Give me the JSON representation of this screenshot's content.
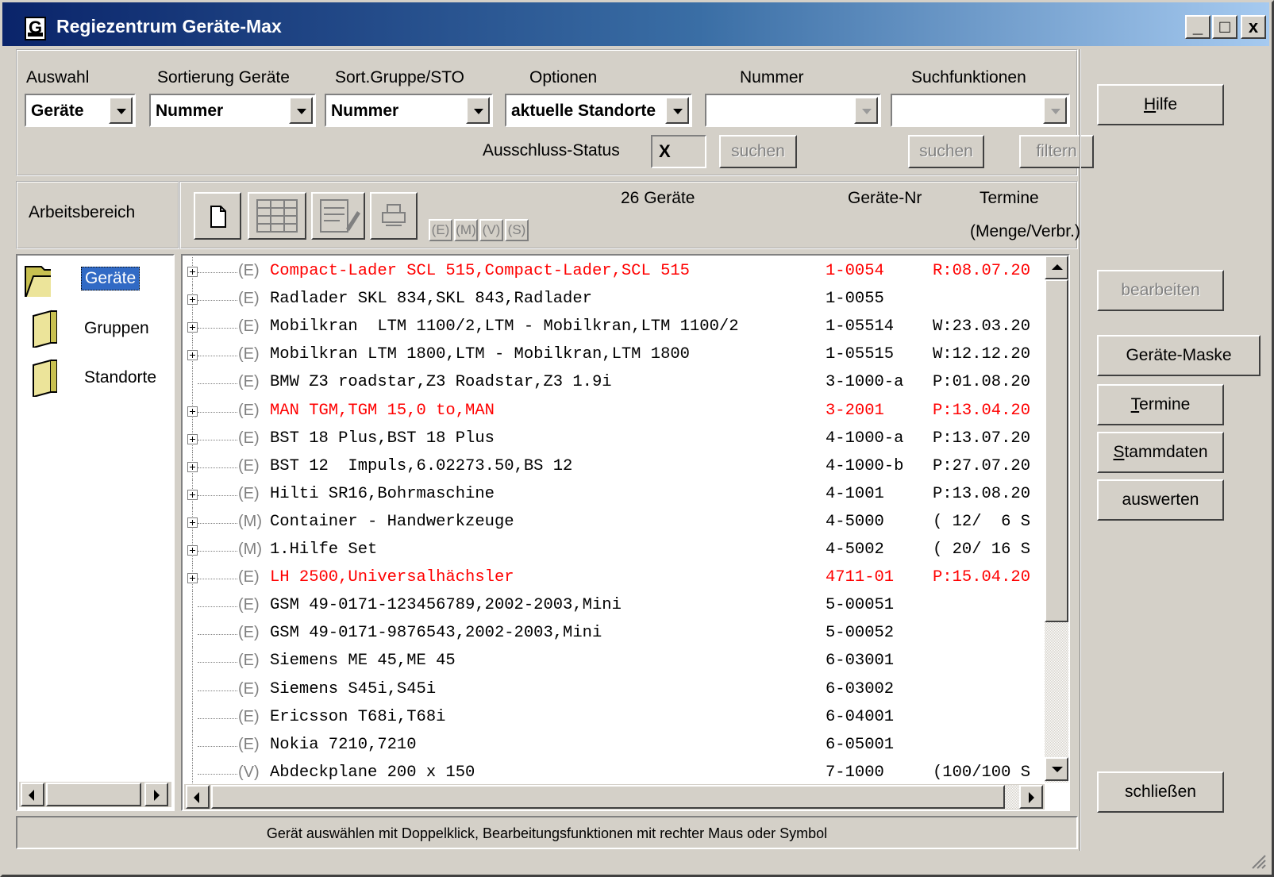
{
  "window": {
    "title": "Regiezentrum Geräte-Max",
    "app_icon_letter": "G",
    "minimize": "_",
    "maximize": "□",
    "close": "x"
  },
  "filters": {
    "auswahl": {
      "label": "Auswahl",
      "value": "Geräte"
    },
    "sortierung_geraete": {
      "label": "Sortierung Geräte",
      "value": "Nummer"
    },
    "sort_gruppe": {
      "label": "Sort.Gruppe/STO",
      "value": "Nummer"
    },
    "optionen": {
      "label": "Optionen",
      "value": "aktuelle Standorte"
    },
    "nummer": {
      "label": "Nummer",
      "value": ""
    },
    "suchfunktionen": {
      "label": "Suchfunktionen",
      "value": ""
    },
    "ausschluss_status": {
      "label": "Ausschluss-Status",
      "value": "X"
    },
    "suchen_nummer": "suchen",
    "suchen_funktion": "suchen",
    "filtern": "filtern"
  },
  "workspace": {
    "label": "Arbeitsbereich",
    "count_label": "26 Geräte",
    "col_nr": "Geräte-Nr",
    "col_termine": "Termine",
    "col_termine_sub": "(Menge/Verbr.)",
    "type_buttons": [
      "(E)",
      "(M)",
      "(V)",
      "(S)"
    ]
  },
  "nav": {
    "items": [
      {
        "label": "Geräte",
        "selected": true
      },
      {
        "label": "Gruppen",
        "selected": false
      },
      {
        "label": "Standorte",
        "selected": false
      }
    ]
  },
  "rows": [
    {
      "kind": "(E)",
      "name": "Compact-Lader SCL 515,Compact-Lader,SCL 515",
      "nr": "1-0054",
      "term": "R:08.07.20",
      "red": true,
      "exp": true
    },
    {
      "kind": "(E)",
      "name": "Radlader SKL 834,SKL 843,Radlader",
      "nr": "1-0055",
      "term": "",
      "red": false,
      "exp": true
    },
    {
      "kind": "(E)",
      "name": "Mobilkran  LTM 1100/2,LTM - Mobilkran,LTM 1100/2",
      "nr": "1-05514",
      "term": "W:23.03.20",
      "red": false,
      "exp": true
    },
    {
      "kind": "(E)",
      "name": "Mobilkran LTM 1800,LTM - Mobilkran,LTM 1800",
      "nr": "1-05515",
      "term": "W:12.12.20",
      "red": false,
      "exp": true
    },
    {
      "kind": "(E)",
      "name": "BMW Z3 roadstar,Z3 Roadstar,Z3 1.9i",
      "nr": "3-1000-a",
      "term": "P:01.08.20",
      "red": false,
      "exp": false
    },
    {
      "kind": "(E)",
      "name": "MAN TGM,TGM 15,0 to,MAN",
      "nr": "3-2001",
      "term": "P:13.04.20",
      "red": true,
      "exp": true
    },
    {
      "kind": "(E)",
      "name": "BST 18 Plus,BST 18 Plus",
      "nr": "4-1000-a",
      "term": "P:13.07.20",
      "red": false,
      "exp": true
    },
    {
      "kind": "(E)",
      "name": "BST 12  Impuls,6.02273.50,BS 12",
      "nr": "4-1000-b",
      "term": "P:27.07.20",
      "red": false,
      "exp": true
    },
    {
      "kind": "(E)",
      "name": "Hilti SR16,Bohrmaschine",
      "nr": "4-1001",
      "term": "P:13.08.20",
      "red": false,
      "exp": true
    },
    {
      "kind": "(M)",
      "name": "Container - Handwerkzeuge",
      "nr": "4-5000",
      "term": "( 12/  6 S",
      "red": false,
      "exp": true
    },
    {
      "kind": "(M)",
      "name": "1.Hilfe Set",
      "nr": "4-5002",
      "term": "( 20/ 16 S",
      "red": false,
      "exp": true
    },
    {
      "kind": "(E)",
      "name": "LH 2500,Universalhächsler",
      "nr": "4711-01",
      "term": "P:15.04.20",
      "red": true,
      "exp": true
    },
    {
      "kind": "(E)",
      "name": "GSM 49-0171-123456789,2002-2003,Mini",
      "nr": "5-00051",
      "term": "",
      "red": false,
      "exp": false
    },
    {
      "kind": "(E)",
      "name": "GSM 49-0171-9876543,2002-2003,Mini",
      "nr": "5-00052",
      "term": "",
      "red": false,
      "exp": false
    },
    {
      "kind": "(E)",
      "name": "Siemens ME 45,ME 45",
      "nr": "6-03001",
      "term": "",
      "red": false,
      "exp": false
    },
    {
      "kind": "(E)",
      "name": "Siemens S45i,S45i",
      "nr": "6-03002",
      "term": "",
      "red": false,
      "exp": false
    },
    {
      "kind": "(E)",
      "name": "Ericsson T68i,T68i",
      "nr": "6-04001",
      "term": "",
      "red": false,
      "exp": false
    },
    {
      "kind": "(E)",
      "name": "Nokia 7210,7210",
      "nr": "6-05001",
      "term": "",
      "red": false,
      "exp": false
    },
    {
      "kind": "(V)",
      "name": "Abdeckplane 200 x 150",
      "nr": "7-1000",
      "term": "(100/100 S",
      "red": false,
      "exp": false
    }
  ],
  "side_buttons": {
    "hilfe": "Hilfe",
    "bearbeiten": "bearbeiten",
    "geraete_maske": "Geräte-Maske",
    "termine": "Termine",
    "stammdaten": "Stammdaten",
    "auswerten": "auswerten",
    "schliessen": "schließen"
  },
  "status_text": "Gerät auswählen mit Doppelklick, Bearbeitungsfunktionen mit rechter Maus oder Symbol",
  "colors": {
    "title_start": "#0a246a",
    "title_end": "#a6caf0",
    "face": "#d4d0c8",
    "selection": "#316ac5",
    "alert": "#ff0000"
  }
}
